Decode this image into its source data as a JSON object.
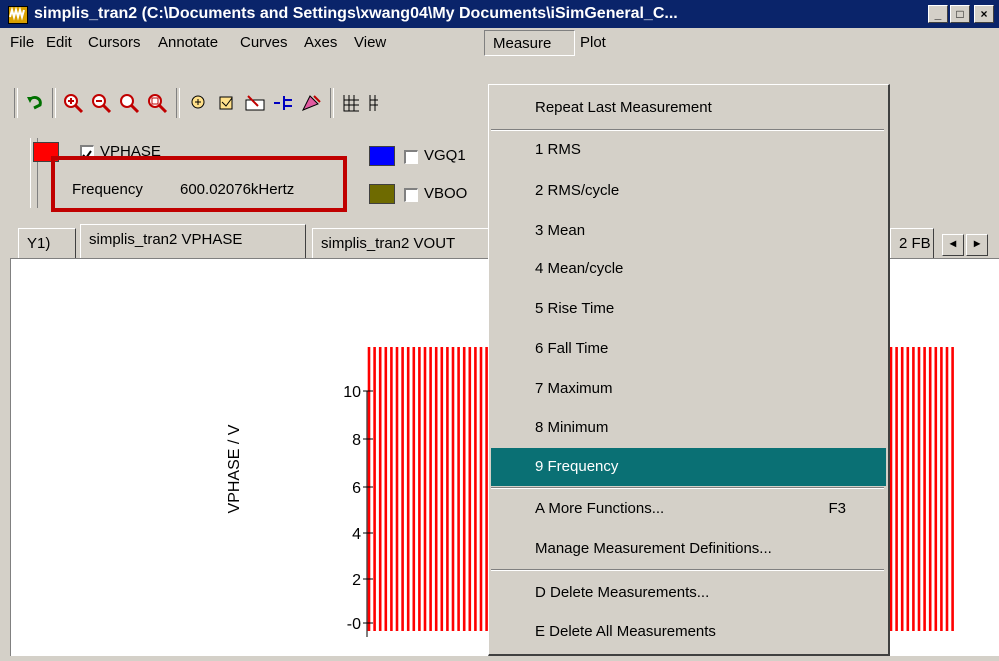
{
  "window": {
    "title": "simplis_tran2 (C:\\Documents and Settings\\xwang04\\My Documents\\iSimGeneral_C...",
    "app_icon": "waveform-icon",
    "controls": [
      "minimize-icon",
      "maximize-icon",
      "close-icon"
    ]
  },
  "menubar": {
    "items": [
      "File",
      "Edit",
      "Cursors",
      "Annotate",
      "Curves",
      "Axes",
      "View",
      "Measure",
      "Plot"
    ]
  },
  "legend": {
    "items": [
      {
        "label": "VPHASE",
        "color": "#ff0000",
        "checked": true
      },
      {
        "label": "VGQ1",
        "color": "#0000ff",
        "checked": false
      },
      {
        "label": "VBOO",
        "color": "#6e6a00",
        "checked": false
      }
    ],
    "measurement": {
      "name": "Frequency",
      "value": "600.02076kHertz"
    },
    "highlight_color": "#c00000"
  },
  "tabs": {
    "items": [
      "Y1)",
      "simplis_tran2 VPHASE",
      "simplis_tran2 VOUT",
      "2 FB"
    ]
  },
  "plot": {
    "ylabel": "VPHASE / V",
    "yticks": [
      "10",
      "8",
      "6",
      "4",
      "2",
      "-0"
    ],
    "trace_color": "#ff0000"
  },
  "dropdown": {
    "items": [
      {
        "label": "Repeat Last Measurement"
      },
      {
        "label": "1 RMS"
      },
      {
        "label": "2 RMS/cycle"
      },
      {
        "label": "3 Mean"
      },
      {
        "label": "4 Mean/cycle"
      },
      {
        "label": "5 Rise Time"
      },
      {
        "label": "6 Fall Time"
      },
      {
        "label": "7 Maximum"
      },
      {
        "label": "8 Minimum"
      },
      {
        "label": "9 Frequency",
        "highlighted": true
      },
      {
        "label": "A More Functions...",
        "shortcut": "F3"
      },
      {
        "label": "Manage Measurement Definitions..."
      },
      {
        "label": "D Delete Measurements..."
      },
      {
        "label": "E Delete All Measurements"
      }
    ],
    "highlight_color": "#0a7074"
  }
}
